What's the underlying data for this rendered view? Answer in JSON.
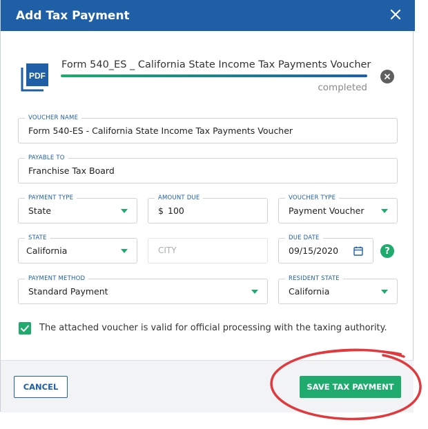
{
  "dialog": {
    "title": "Add Tax Payment",
    "close_icon": "close-icon"
  },
  "file": {
    "icon": "pdf-file-icon",
    "icon_text": "PDF",
    "name": "Form 540_ES _ California State Income Tax Payments Voucher",
    "progress_percent": 100,
    "status": "completed",
    "remove_icon": "remove-file-icon"
  },
  "form": {
    "voucher_name": {
      "label": "VOUCHER NAME",
      "value": "Form 540-ES - California State Income Tax Payments Voucher"
    },
    "payable_to": {
      "label": "PAYABLE TO",
      "value": "Franchise Tax Board"
    },
    "payment_type": {
      "label": "PAYMENT TYPE",
      "value": "State"
    },
    "amount_due": {
      "label": "AMOUNT DUE",
      "currency": "$",
      "value": "100"
    },
    "voucher_type": {
      "label": "VOUCHER TYPE",
      "value": "Payment Voucher"
    },
    "state": {
      "label": "STATE",
      "value": "California"
    },
    "city": {
      "placeholder": "CITY"
    },
    "due_date": {
      "label": "DUE DATE",
      "value": "09/15/2020"
    },
    "payment_method": {
      "label": "PAYMENT METHOD",
      "value": "Standard Payment"
    },
    "resident_state": {
      "label": "RESIDENT STATE",
      "value": "California"
    },
    "help_icon": "?"
  },
  "validation": {
    "checked": true,
    "label": "The attached voucher is valid for official processing with the taxing authority."
  },
  "footer": {
    "cancel_label": "CANCEL",
    "save_label": "SAVE TAX PAYMENT"
  },
  "colors": {
    "header": "#1e5fa5",
    "accent_green": "#1faa6e",
    "annotation_red": "#e0393e"
  }
}
